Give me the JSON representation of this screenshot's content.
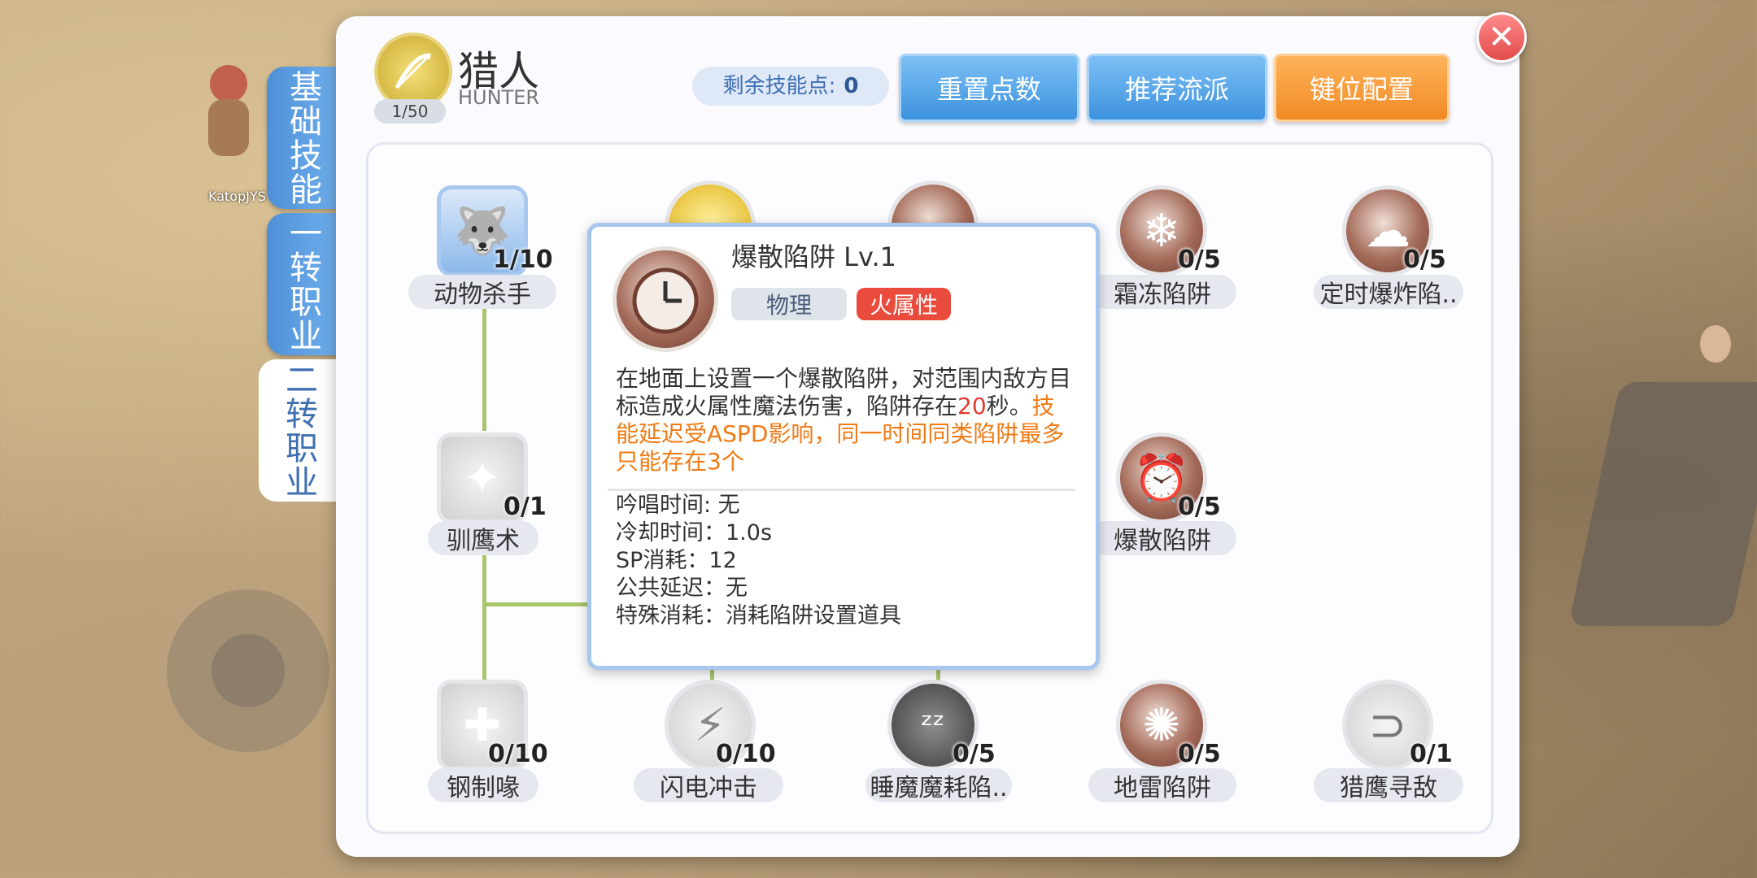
{
  "character": {
    "name": "KatopJYS"
  },
  "side_tabs": [
    {
      "label": "基础技能"
    },
    {
      "label": "一转职业"
    },
    {
      "label": "二转职业"
    }
  ],
  "class_info": {
    "name": "猎人",
    "name_en": "HUNTER",
    "level": "1/50"
  },
  "skill_points": {
    "label": "剩余技能点:",
    "value": "0"
  },
  "buttons": {
    "reset": "重置点数",
    "recommend": "推荐流派",
    "keybind": "键位配置",
    "close": "✕"
  },
  "skills": [
    {
      "name": "动物杀手",
      "count": "1/10",
      "icon": "wolf-icon"
    },
    {
      "name": "霜冻陷阱",
      "count": "0/5",
      "icon": "frost-trap-icon"
    },
    {
      "name": "定时爆炸陷..",
      "count": "0/5",
      "icon": "explosion-icon"
    },
    {
      "name": "驯鹰术",
      "count": "0/1",
      "icon": "falcon-icon"
    },
    {
      "name": "爆散陷阱",
      "count": "0/5",
      "icon": "clock-icon"
    },
    {
      "name": "钢制喙",
      "count": "0/10",
      "icon": "steel-beak-icon"
    },
    {
      "name": "闪电冲击",
      "count": "0/10",
      "icon": "lightning-icon"
    },
    {
      "name": "睡魔魔耗陷..",
      "count": "0/5",
      "icon": "sleep-icon"
    },
    {
      "name": "地雷陷阱",
      "count": "0/5",
      "icon": "landmine-icon"
    },
    {
      "name": "猎鹰寻敌",
      "count": "0/1",
      "icon": "magnet-icon"
    }
  ],
  "tooltip": {
    "title": "爆散陷阱 Lv.1",
    "tag_type": "物理",
    "tag_element": "火属性",
    "desc_part1": "在地面上设置一个爆散陷阱，对范围内敌方目标造成火属性魔法伤害，陷阱存在",
    "desc_highlight_red": "20",
    "desc_part2": "秒。",
    "desc_highlight_orange": "技能延迟受ASPD影响，同一时间同类陷阱最多只能存在3个",
    "stats": [
      "吟唱时间: 无",
      "冷却时间：1.0s",
      "SP消耗：12",
      "公共延迟：无",
      "特殊消耗：消耗陷阱设置道具"
    ]
  },
  "colors": {
    "accent_blue": "#3d92dd",
    "accent_orange": "#f08a25",
    "fire_red": "#e94b3c",
    "tree_line": "#a9c56a"
  }
}
